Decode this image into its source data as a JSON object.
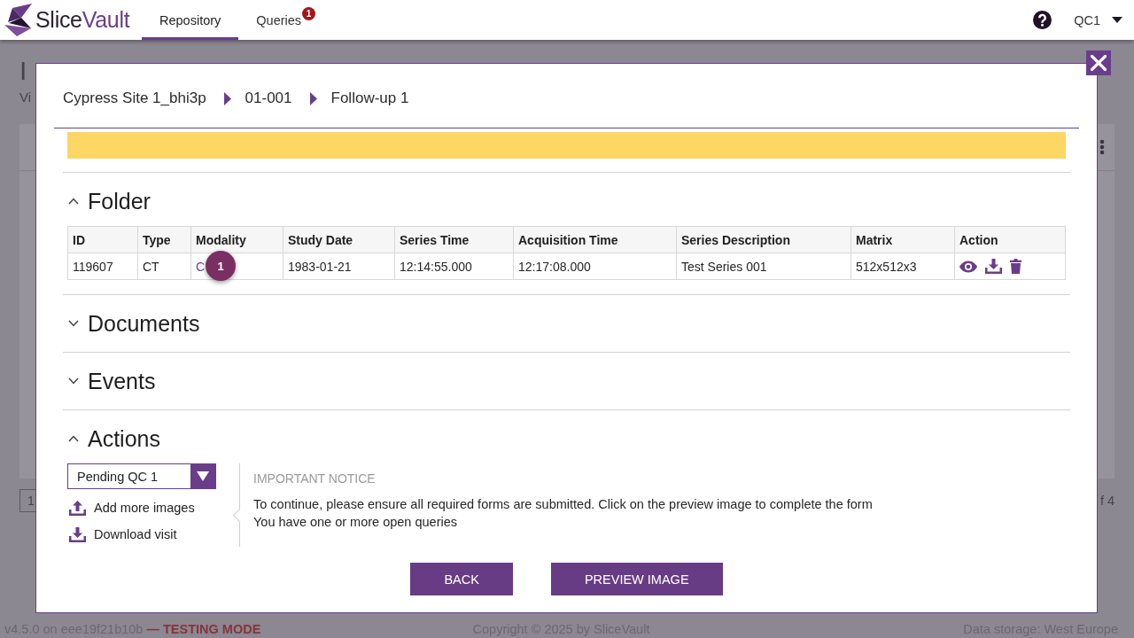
{
  "header": {
    "brand": "Slice**Vault**",
    "tabs": [
      {
        "label": "Repository",
        "selected": true
      },
      {
        "label": "Queries",
        "selected": false,
        "badge": "1"
      }
    ],
    "user": "QC1"
  },
  "background": {
    "title": "I",
    "subtitle": "Vi",
    "page": "1",
    "page_count": "f 4"
  },
  "modal": {
    "breadcrumb": [
      "Cypress Site 1_bhi3p",
      "01-001",
      "Follow-up 1"
    ],
    "sections": [
      {
        "title": "Folder",
        "expanded": true,
        "kind": "table",
        "table": {
          "columns": [
            {
              "label": "ID",
              "kind": "text"
            },
            {
              "label": "Type",
              "kind": "text"
            },
            {
              "label": "Modality",
              "kind": "link"
            },
            {
              "label": "Study Date",
              "kind": "text"
            },
            {
              "label": "Series Time",
              "kind": "text"
            },
            {
              "label": "Acquisition Time",
              "kind": "text"
            },
            {
              "label": "Series Description",
              "kind": "text"
            },
            {
              "label": "Matrix",
              "kind": "text"
            },
            {
              "label": "Action",
              "kind": "actions"
            }
          ],
          "rows": [
            {
              "cells": [
                "119607",
                "CT",
                "C",
                "1983-01-21",
                "12:14:55.000",
                "12:17:08.000",
                "Test Series 001",
                "512x512x3"
              ],
              "marker": "1"
            }
          ]
        }
      },
      {
        "title": "Documents",
        "expanded": false
      },
      {
        "title": "Events",
        "expanded": false
      },
      {
        "title": "Actions",
        "expanded": true,
        "kind": "actions",
        "status": "Pending QC 1",
        "links": [
          {
            "label": "Add more images",
            "kind": "upload"
          },
          {
            "label": "Download visit",
            "kind": "download"
          }
        ],
        "notice": {
          "title": "IMPORTANT NOTICE",
          "lines": [
            "To continue, please ensure all required forms are submitted. Click on the preview image to complete the form",
            "You have one or more open queries"
          ]
        }
      }
    ],
    "buttons": [
      "BACK",
      "PREVIEW IMAGE"
    ]
  },
  "footer": {
    "version": "v4.5.0 on eee19f21b10b **— TESTING MODE**",
    "copyright": "Copyright © 2025 by SliceVault",
    "storage": "Data storage: West Europe"
  }
}
